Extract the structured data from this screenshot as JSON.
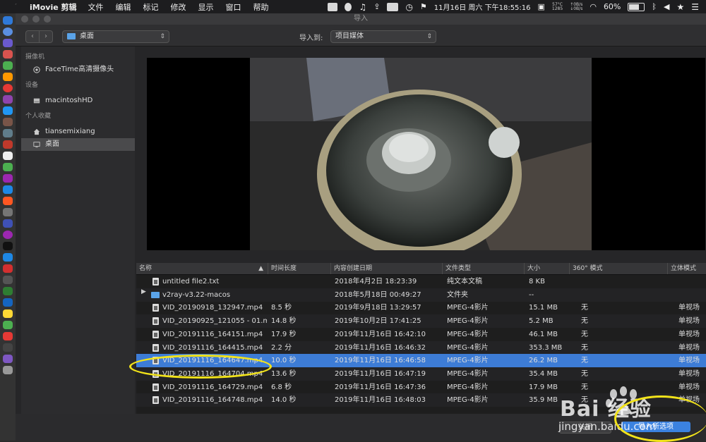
{
  "menubar": {
    "app_name": "iMovie 剪辑",
    "menus": [
      "文件",
      "编辑",
      "标记",
      "修改",
      "显示",
      "窗口",
      "帮助"
    ],
    "temp": "57°C",
    "rpm": "1285",
    "net_up": "0B/s",
    "net_down": "0B/s",
    "battery": "60%",
    "datetime": "11月16日 周六 下午18:55:16"
  },
  "dialog": {
    "title": "导入",
    "location": "桌面",
    "import_to_label": "导入到:",
    "import_to_value": "项目媒体"
  },
  "sidebar": {
    "sections": [
      {
        "heading": "摄像机",
        "items": [
          {
            "label": "FaceTime高清摄像头",
            "icon": "camera-icon"
          }
        ]
      },
      {
        "heading": "设备",
        "items": [
          {
            "label": "macintoshHD",
            "icon": "hard-drive-icon"
          }
        ]
      },
      {
        "heading": "个人收藏",
        "items": [
          {
            "label": "tiansemixiang",
            "icon": "home-icon"
          },
          {
            "label": "桌面",
            "icon": "desktop-icon",
            "selected": true
          }
        ]
      }
    ]
  },
  "table": {
    "columns": [
      "名称",
      "时间长度",
      "内容创建日期",
      "文件类型",
      "大小",
      "360° 模式",
      "立体模式"
    ],
    "rows": [
      {
        "name": "untitled file2.txt",
        "duration": "",
        "date": "2018年4月2日 18:23:39",
        "type": "纯文本文稿",
        "size": "8 KB",
        "mode360": "",
        "stereo": "",
        "kind": "file"
      },
      {
        "name": "v2ray-v3.22-macos",
        "duration": "",
        "date": "2018年5月18日 00:49:27",
        "type": "文件夹",
        "size": "--",
        "mode360": "",
        "stereo": "",
        "kind": "folder"
      },
      {
        "name": "VID_20190918_132947.mp4",
        "duration": "8.5 秒",
        "date": "2019年9月18日 13:29:57",
        "type": "MPEG-4影片",
        "size": "15.1 MB",
        "mode360": "无",
        "stereo": "单视场",
        "kind": "file"
      },
      {
        "name": "VID_20190925_121055 - 01.m...",
        "duration": "14.8 秒",
        "date": "2019年10月2日 17:41:25",
        "type": "MPEG-4影片",
        "size": "5.2 MB",
        "mode360": "无",
        "stereo": "单视场",
        "kind": "file"
      },
      {
        "name": "VID_20191116_164151.mp4",
        "duration": "17.9 秒",
        "date": "2019年11月16日 16:42:10",
        "type": "MPEG-4影片",
        "size": "46.1 MB",
        "mode360": "无",
        "stereo": "单视场",
        "kind": "file"
      },
      {
        "name": "VID_20191116_164415.mp4",
        "duration": "2.2 分",
        "date": "2019年11月16日 16:46:32",
        "type": "MPEG-4影片",
        "size": "353.3 MB",
        "mode360": "无",
        "stereo": "单视场",
        "kind": "file"
      },
      {
        "name": "VID_20191116_164647.mp4",
        "duration": "10.0 秒",
        "date": "2019年11月16日 16:46:58",
        "type": "MPEG-4影片",
        "size": "26.2 MB",
        "mode360": "无",
        "stereo": "单视场",
        "kind": "file",
        "selected": true
      },
      {
        "name": "VID_20191116_164704.mp4",
        "duration": "13.6 秒",
        "date": "2019年11月16日 16:47:19",
        "type": "MPEG-4影片",
        "size": "35.4 MB",
        "mode360": "无",
        "stereo": "单视场",
        "kind": "file"
      },
      {
        "name": "VID_20191116_164729.mp4",
        "duration": "6.8 秒",
        "date": "2019年11月16日 16:47:36",
        "type": "MPEG-4影片",
        "size": "17.9 MB",
        "mode360": "无",
        "stereo": "单视场",
        "kind": "file"
      },
      {
        "name": "VID_20191116_164748.mp4",
        "duration": "14.0 秒",
        "date": "2019年11月16日 16:48:03",
        "type": "MPEG-4影片",
        "size": "35.9 MB",
        "mode360": "无",
        "stereo": "单视场",
        "kind": "file"
      }
    ]
  },
  "footer": {
    "close_label": "关闭",
    "import_label": "导入所选项"
  },
  "watermark": {
    "brand": "Bai  经验",
    "url": "jingyan.baidu.com"
  },
  "colors": {
    "selection": "#3d7cd6",
    "highlight_circle": "#f2e31a",
    "folder": "#5aa3e8"
  }
}
